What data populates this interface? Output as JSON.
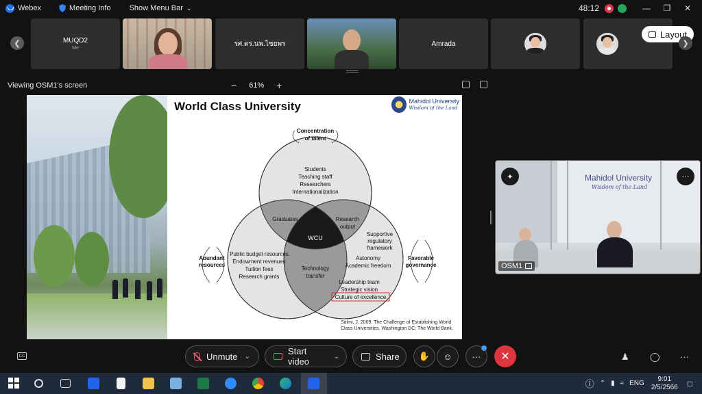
{
  "titlebar": {
    "app_name": "Webex",
    "meeting_info": "Meeting Info",
    "menu_bar": "Show Menu Bar",
    "timer": "48:12",
    "minimize": "—",
    "restore": "❐",
    "close": "✕"
  },
  "participants": [
    {
      "name": "MUQD2",
      "sub": "Me"
    },
    {
      "name": "",
      "sub": ""
    },
    {
      "name": "รศ.ดร.นพ.ไชยพร",
      "sub": ""
    },
    {
      "name": "",
      "sub": ""
    },
    {
      "name": "Amrada",
      "sub": ""
    },
    {
      "name": "",
      "sub": ""
    },
    {
      "name": "",
      "sub": ""
    }
  ],
  "layout_button": "Layout",
  "share_header": {
    "viewing": "Viewing OSM1's screen",
    "zoom_minus": "−",
    "zoom_level": "61%",
    "zoom_plus": "+"
  },
  "slide": {
    "title": "World Class University",
    "logo_name": "Mahidol University",
    "logo_motto": "Wisdom of the Land",
    "top_label_1": "Concentration",
    "top_label_2": "of talent",
    "left_label_1": "Abundant",
    "left_label_2": "resources",
    "right_label_1": "Favorable",
    "right_label_2": "governance",
    "top_circle": [
      "Students",
      "Teaching staff",
      "Researchers",
      "Internationalization"
    ],
    "left_circle": [
      "Public budget resources",
      "Endowment revenues",
      "Tuition fees",
      "Research grants"
    ],
    "right_circle": [
      "Supportive",
      "regulatory",
      "framework",
      "Autonomy",
      "Academic freedom",
      "Leadership team",
      "Strategic vision",
      "Culture of excellence"
    ],
    "overlap_top_left": "Graduates",
    "overlap_top_right": [
      "Research",
      "output"
    ],
    "overlap_bottom": [
      "Technology",
      "transfer"
    ],
    "center": "WCU",
    "citation_1": "Salmi, J. 2009. The Challenge of Establishing World",
    "citation_2": "Class Universities. Washington DC: The World Bank."
  },
  "selfview": {
    "label": "OSM1",
    "wall_logo": "Mahidol University",
    "wall_motto": "Wisdom of the Land"
  },
  "controls": {
    "unmute": "Unmute",
    "start_video": "Start video",
    "share": "Share",
    "more": "···",
    "end": "✕"
  },
  "taskbar": {
    "lang": "ENG",
    "time": "9:01",
    "date": "2/5/2566"
  },
  "colors": {
    "end_red": "#e0343e",
    "muted_red": "#f06070",
    "highlight_box": "#d62828",
    "venn_center": "#1a1a1a"
  }
}
